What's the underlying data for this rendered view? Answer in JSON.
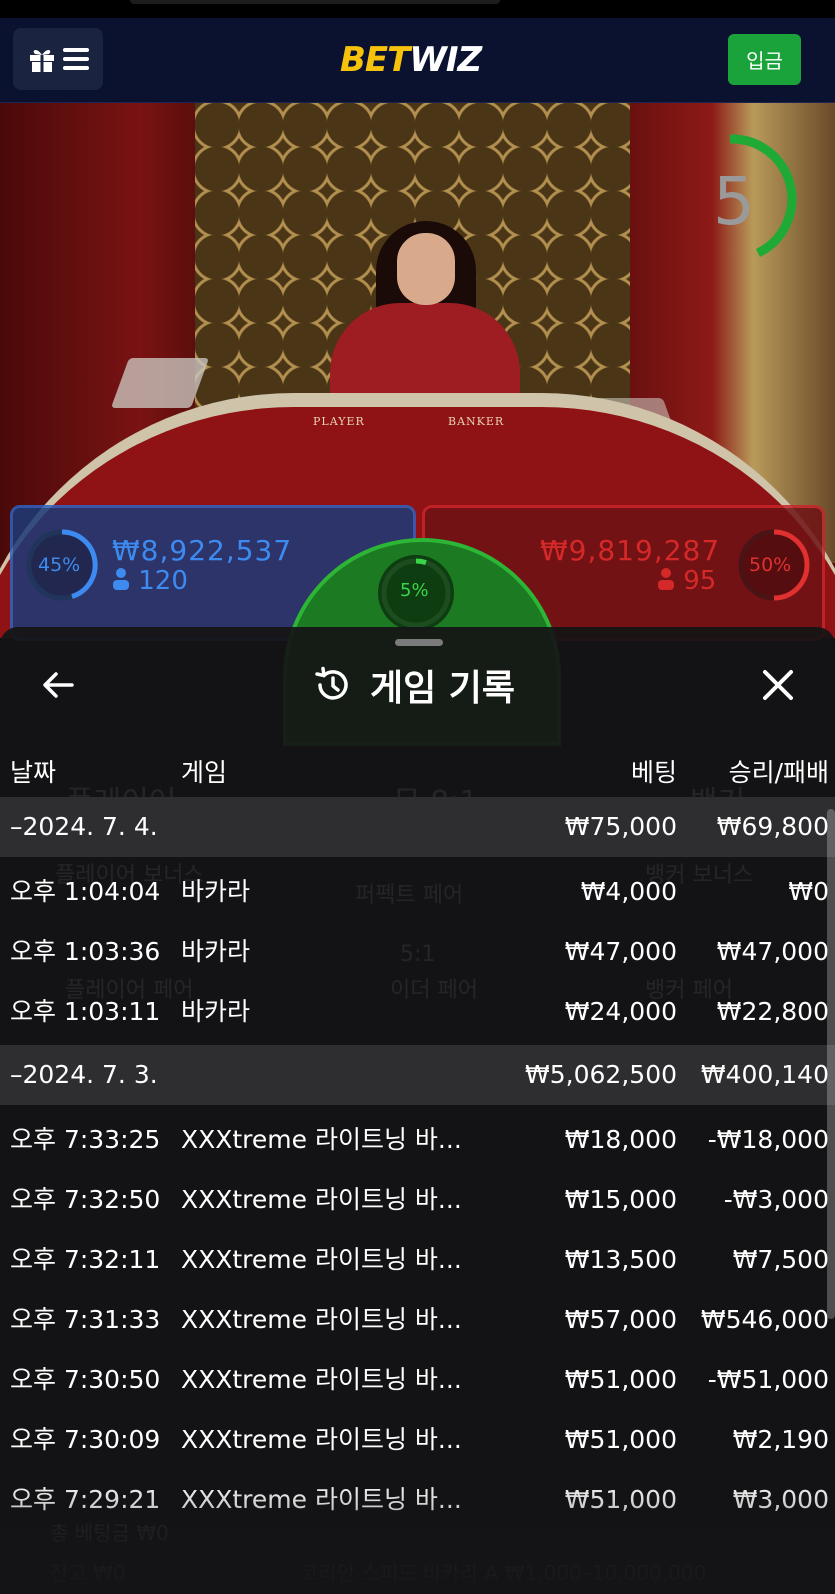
{
  "header": {
    "logo_part1": "BET",
    "logo_part2": "WIZ",
    "deposit_label": "입금"
  },
  "game_view": {
    "countdown": "5",
    "table_labels": [
      "PLAYER",
      "BANKER"
    ],
    "player": {
      "percent": "45%",
      "amount": "₩8,922,537",
      "players": "120"
    },
    "banker": {
      "percent": "50%",
      "amount": "₩9,819,287",
      "players": "95"
    },
    "tie": {
      "percent": "5%"
    }
  },
  "history": {
    "title": "게임 기록",
    "columns": {
      "date": "날짜",
      "game": "게임",
      "bet": "베팅",
      "win_loss": "승리/패배"
    },
    "rows": [
      {
        "type": "group",
        "date": "–2024. 7. 4.",
        "game": "",
        "bet": "₩75,000",
        "win": "₩69,800"
      },
      {
        "type": "item",
        "date": "오후 1:04:04",
        "game": "바카라",
        "bet": "₩4,000",
        "win": "₩0"
      },
      {
        "type": "item",
        "date": "오후 1:03:36",
        "game": "바카라",
        "bet": "₩47,000",
        "win": "₩47,000"
      },
      {
        "type": "item",
        "date": "오후 1:03:11",
        "game": "바카라",
        "bet": "₩24,000",
        "win": "₩22,800"
      },
      {
        "type": "group",
        "date": "–2024. 7. 3.",
        "game": "",
        "bet": "₩5,062,500",
        "win": "₩400,140"
      },
      {
        "type": "item",
        "date": "오후 7:33:25",
        "game": "XXXtreme 라이트닝 바...",
        "bet": "₩18,000",
        "win": "-₩18,000"
      },
      {
        "type": "item",
        "date": "오후 7:32:50",
        "game": "XXXtreme 라이트닝 바...",
        "bet": "₩15,000",
        "win": "-₩3,000"
      },
      {
        "type": "item",
        "date": "오후 7:32:11",
        "game": "XXXtreme 라이트닝 바...",
        "bet": "₩13,500",
        "win": "₩7,500"
      },
      {
        "type": "item",
        "date": "오후 7:31:33",
        "game": "XXXtreme 라이트닝 바...",
        "bet": "₩57,000",
        "win": "₩546,000"
      },
      {
        "type": "item",
        "date": "오후 7:30:50",
        "game": "XXXtreme 라이트닝 바...",
        "bet": "₩51,000",
        "win": "-₩51,000"
      },
      {
        "type": "item",
        "date": "오후 7:30:09",
        "game": "XXXtreme 라이트닝 바...",
        "bet": "₩51,000",
        "win": "₩2,190"
      },
      {
        "type": "item",
        "date": "오후 7:29:21",
        "game": "XXXtreme 라이트닝 바...",
        "bet": "₩51,000",
        "win": "₩3,000"
      }
    ]
  },
  "background_ui": {
    "labels": [
      "플레이어",
      "무 8:1",
      "뱅커",
      "플레이어 보너스",
      "퍼펙트 페어",
      "뱅커 보너스",
      "5:1",
      "이더 페어",
      "플레이어 페어",
      "뱅커 페어"
    ],
    "total_bet": "총 베팅금 ₩0",
    "balance": "잔고 ₩0",
    "table_info": "코리안 스피드 바카라 A ₩1,000–10,000,000"
  },
  "colors": {
    "header_bg": "#0a1230",
    "deposit_button": "#1aa33a",
    "player_blue": "#3d8bf0",
    "banker_red": "#d52828",
    "tie_green": "#2db536",
    "sheet_bg": "#141416",
    "group_row_bg": "#2e2e30"
  },
  "icons": {
    "menu": "gift-icon + hamburger-icon",
    "back": "arrow-left-icon",
    "history": "history-clock-icon",
    "close": "close-icon",
    "players": "user-icon"
  }
}
